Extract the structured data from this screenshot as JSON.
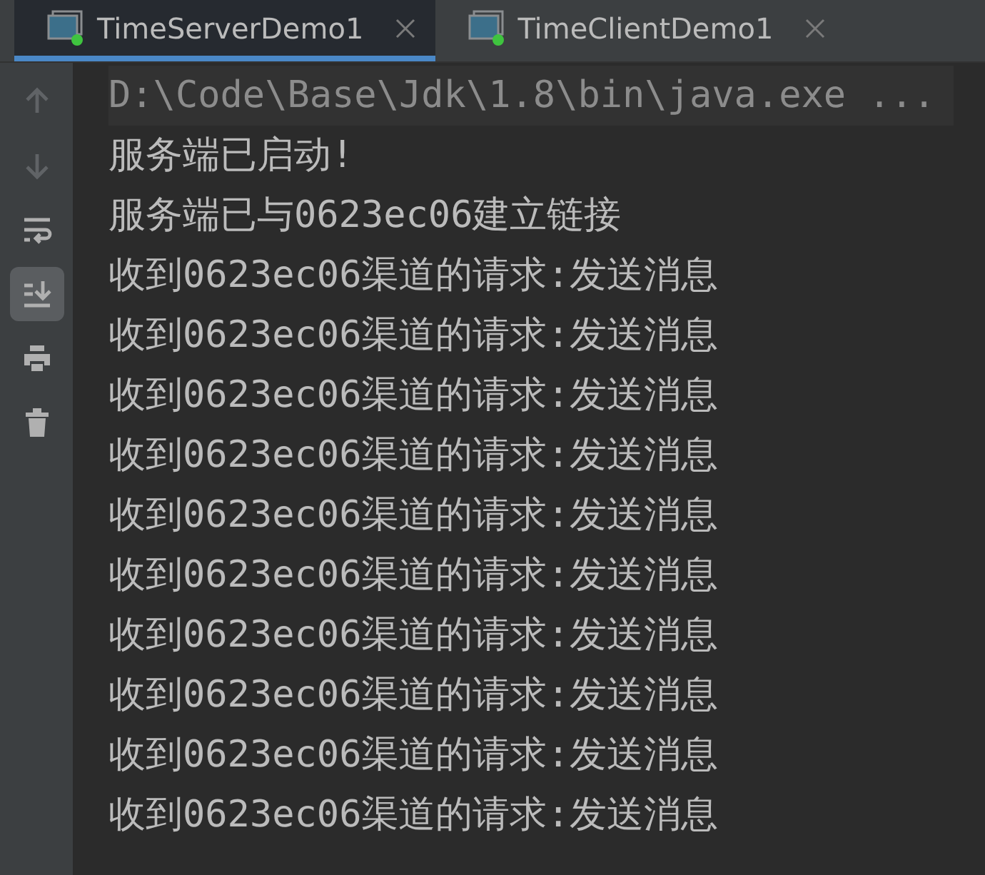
{
  "tabs": [
    {
      "label": "TimeServerDemo1",
      "selected": true
    },
    {
      "label": "TimeClientDemo1",
      "selected": false
    }
  ],
  "toolbar": [
    {
      "kind": "up",
      "disabled": true,
      "selected": false
    },
    {
      "kind": "down",
      "disabled": true,
      "selected": false
    },
    {
      "kind": "wrap",
      "disabled": false,
      "selected": false
    },
    {
      "kind": "scroll-end",
      "disabled": false,
      "selected": true
    },
    {
      "kind": "print",
      "disabled": false,
      "selected": false
    },
    {
      "kind": "trash",
      "disabled": false,
      "selected": false
    }
  ],
  "console": [
    {
      "kind": "command",
      "text": "D:\\Code\\Base\\Jdk\\1.8\\bin\\java.exe ..."
    },
    {
      "kind": "output",
      "text": "服务端已启动!"
    },
    {
      "kind": "output",
      "text": "服务端已与0623ec06建立链接"
    },
    {
      "kind": "output",
      "text": "收到0623ec06渠道的请求:发送消息"
    },
    {
      "kind": "output",
      "text": "收到0623ec06渠道的请求:发送消息"
    },
    {
      "kind": "output",
      "text": "收到0623ec06渠道的请求:发送消息"
    },
    {
      "kind": "output",
      "text": "收到0623ec06渠道的请求:发送消息"
    },
    {
      "kind": "output",
      "text": "收到0623ec06渠道的请求:发送消息"
    },
    {
      "kind": "output",
      "text": "收到0623ec06渠道的请求:发送消息"
    },
    {
      "kind": "output",
      "text": "收到0623ec06渠道的请求:发送消息"
    },
    {
      "kind": "output",
      "text": "收到0623ec06渠道的请求:发送消息"
    },
    {
      "kind": "output",
      "text": "收到0623ec06渠道的请求:发送消息"
    },
    {
      "kind": "output",
      "text": "收到0623ec06渠道的请求:发送消息"
    }
  ]
}
